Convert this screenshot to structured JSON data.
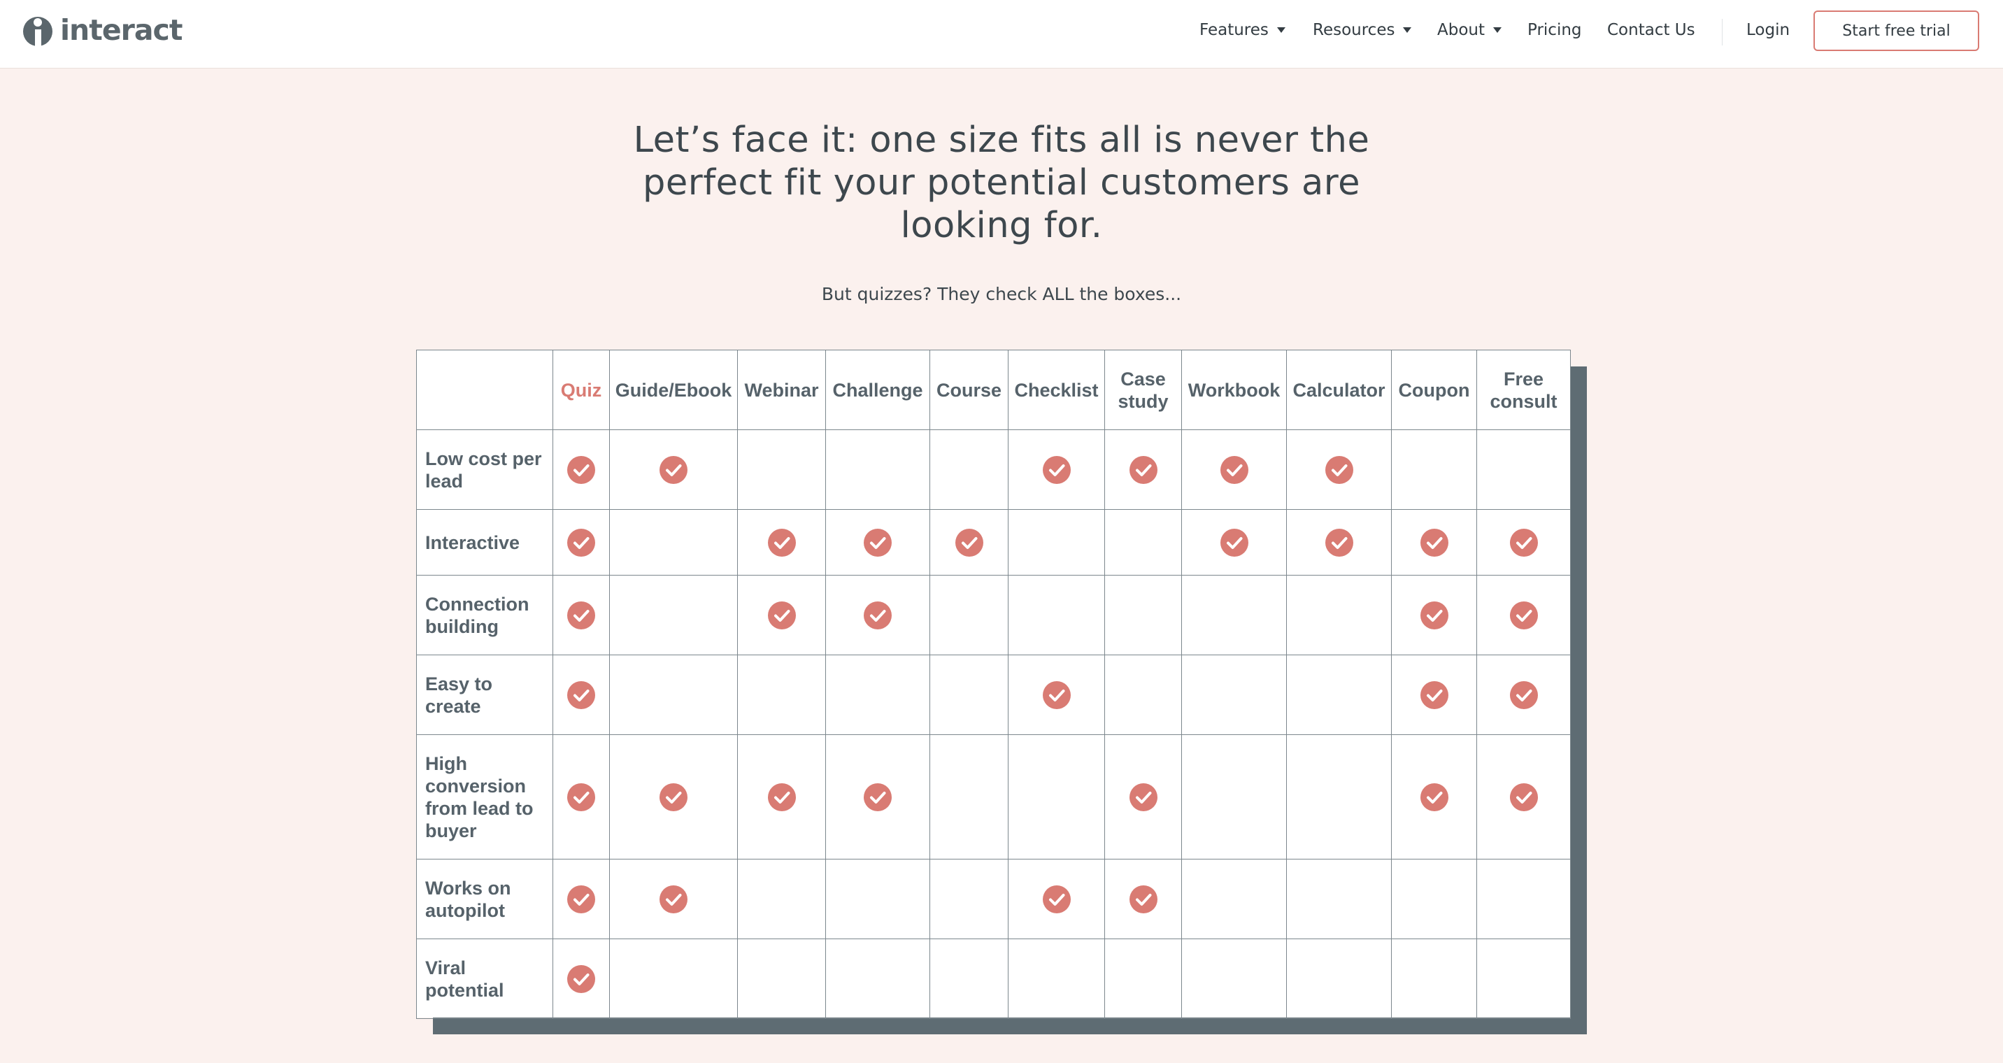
{
  "brand": {
    "name": "interact",
    "accent": "#d97b73",
    "shadow": "#5e6c73",
    "background": "#fbf1ee"
  },
  "nav": {
    "items": [
      {
        "label": "Features",
        "dropdown": true
      },
      {
        "label": "Resources",
        "dropdown": true
      },
      {
        "label": "About",
        "dropdown": true
      },
      {
        "label": "Pricing",
        "dropdown": false
      },
      {
        "label": "Contact Us",
        "dropdown": false
      }
    ],
    "login": "Login",
    "cta": "Start free trial"
  },
  "hero": {
    "headline_lines": [
      "Let’s face it: one size fits all is never the",
      "perfect fit your potential customers are",
      "looking for."
    ],
    "subhead": "But quizzes? They check ALL the boxes..."
  },
  "table": {
    "columns": [
      "Quiz",
      "Guide/Ebook",
      "Webinar",
      "Challenge",
      "Course",
      "Checklist",
      "Case study",
      "Workbook",
      "Calculator",
      "Coupon",
      "Free consult"
    ],
    "rows": [
      {
        "label": "Low cost per lead",
        "checks": [
          true,
          true,
          false,
          false,
          false,
          true,
          true,
          true,
          true,
          false,
          false
        ]
      },
      {
        "label": "Interactive",
        "checks": [
          true,
          false,
          true,
          true,
          true,
          false,
          false,
          true,
          true,
          true,
          true
        ]
      },
      {
        "label": "Connection building",
        "checks": [
          true,
          false,
          true,
          true,
          false,
          false,
          false,
          false,
          false,
          true,
          true
        ]
      },
      {
        "label": "Easy to create",
        "checks": [
          true,
          false,
          false,
          false,
          false,
          true,
          false,
          false,
          false,
          true,
          true
        ]
      },
      {
        "label": "High conversion from lead to buyer",
        "checks": [
          true,
          true,
          true,
          true,
          false,
          false,
          true,
          false,
          false,
          true,
          true
        ]
      },
      {
        "label": "Works on autopilot",
        "checks": [
          true,
          true,
          false,
          false,
          false,
          true,
          true,
          false,
          false,
          false,
          false
        ]
      },
      {
        "label": "Viral potential",
        "checks": [
          true,
          false,
          false,
          false,
          false,
          false,
          false,
          false,
          false,
          false,
          false
        ]
      }
    ]
  }
}
